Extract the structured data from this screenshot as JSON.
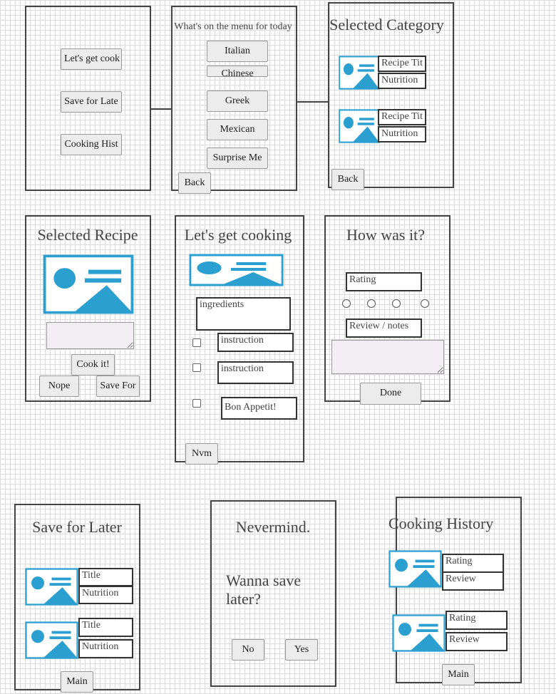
{
  "screen1": {
    "buttons": [
      "Let's get cook",
      "Save for Late",
      "Cooking Hist"
    ]
  },
  "screen2": {
    "title": "What's on the menu for today",
    "categories": [
      "Italian",
      "Chinese",
      "Greek",
      "Mexican",
      "Surprise Me"
    ],
    "back_label": "Back"
  },
  "screen3": {
    "title": "Selected Category",
    "items": [
      {
        "title": "Recipe Tit",
        "nutrition": "Nutrition"
      },
      {
        "title": "Recipe Tit",
        "nutrition": "Nutrition"
      }
    ],
    "back_label": "Back"
  },
  "screen4": {
    "title": "Selected Recipe",
    "cook_label": "Cook it!",
    "nope_label": "Nope",
    "save_label": "Save For"
  },
  "screen5": {
    "title": "Let's get cooking",
    "ingredients": "ingredients",
    "steps": [
      "instruction",
      "instruction",
      "Bon Appetit!"
    ],
    "nvm_label": "Nvm"
  },
  "screen6": {
    "title": "How was it?",
    "rating_label": "Rating",
    "review_label": "Review / notes",
    "done_label": "Done"
  },
  "screen7": {
    "title": "Save for Later",
    "items": [
      {
        "title": "Title",
        "nutrition": "Nutrition"
      },
      {
        "title": "Title",
        "nutrition": "Nutrition"
      }
    ],
    "main_label": "Main"
  },
  "screen8": {
    "title": "Nevermind.",
    "prompt": "Wanna save later?",
    "no_label": "No",
    "yes_label": "Yes"
  },
  "screen9": {
    "title": "Cooking History",
    "items": [
      {
        "rating": "Rating",
        "review": "Review"
      },
      {
        "rating": "Rating",
        "review": "Review"
      }
    ],
    "main_label": "Main"
  },
  "colors": {
    "image_icon": "#2a9fd0",
    "frame": "#444444",
    "textarea_bg": "#f3eef4"
  }
}
